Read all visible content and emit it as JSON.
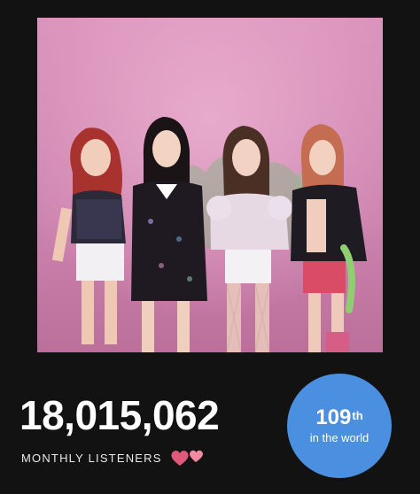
{
  "artist": {
    "image_alt": "artist-group-photo"
  },
  "stats": {
    "monthly_listeners": "18,015,062",
    "monthly_listeners_label": "MONTHLY LISTENERS",
    "rank_number": "109",
    "rank_suffix": "th",
    "rank_caption": "in the world",
    "rank_color": "#4a8fe0"
  },
  "icons": {
    "hearts": "two-hearts-icon"
  },
  "colors": {
    "background": "#121212",
    "badge": "#4a8fe0",
    "hearts_dark": "#e0597a",
    "hearts_light": "#f28aa2"
  }
}
